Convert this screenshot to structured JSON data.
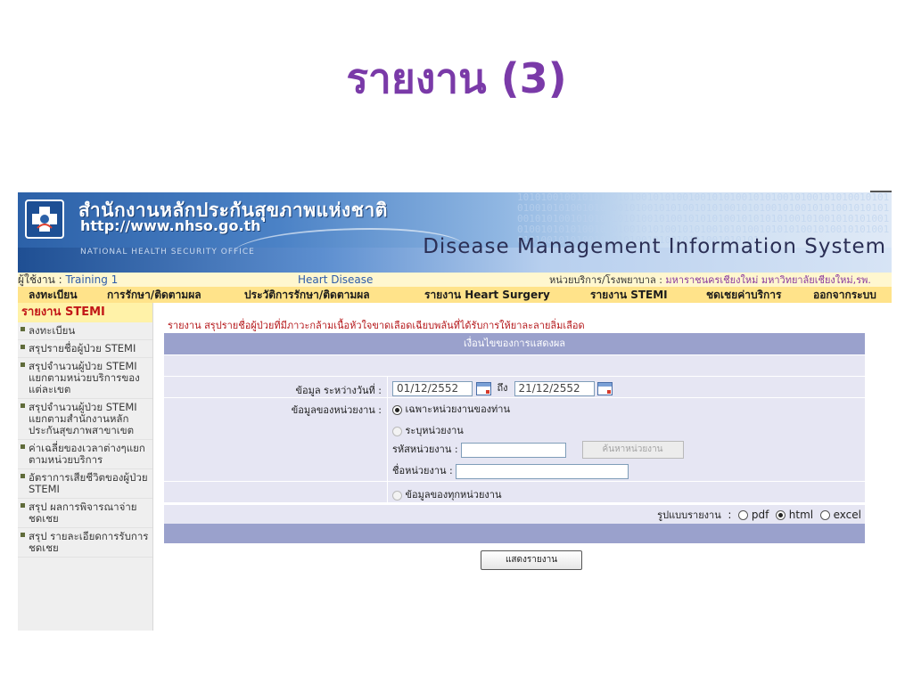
{
  "slide": {
    "title": "รายงาน (3)"
  },
  "banner": {
    "org_name_th": "สำนักงานหลักประกันสุขภาพแห่งชาติ",
    "org_url": "http://www.nhso.go.th",
    "org_name_en": "NATIONAL HEALTH SECURITY OFFICE",
    "system_name": "Disease Management Information System"
  },
  "info_bar": {
    "user_label": "ผู้ใช้งาน : ",
    "user_value": "Training 1",
    "program": "Heart Disease",
    "unit_label": "หน่วยบริการ/โรงพยาบาล : ",
    "unit_value": "มหาราชนครเชียงใหม่ มหาวิทยาลัยเชียงใหม่,รพ."
  },
  "menu": {
    "items": [
      "ลงทะเบียน",
      "การรักษา/ติดตามผล",
      "ประวัติการรักษา/ติดตามผล",
      "รายงาน Heart Surgery",
      "รายงาน STEMI",
      "ชดเชยค่าบริการ",
      "ออกจากระบบ"
    ]
  },
  "sidebar": {
    "header": "รายงาน STEMI",
    "items": [
      "ลงทะเบียน",
      "สรุปรายชื่อผู้ป่วย STEMI",
      "สรุปจำนวนผู้ป่วย STEMI แยกตามหน่วยบริการของแต่ละเขต",
      "สรุปจำนวนผู้ป่วย STEMI แยกตามสำนักงานหลักประกันสุขภาพสาขาเขต",
      "ค่าเฉลี่ยของเวลาต่างๆแยกตามหน่วยบริการ",
      "อัตราการเสียชีวิตของผู้ป่วย STEMI",
      "สรุป ผลการพิจารณาจ่ายชดเชย",
      "สรุป รายละเอียดการรับการชดเชย"
    ]
  },
  "main": {
    "report_title": "รายงาน สรุปรายชื่อผู้ป่วยที่มีภาวะกล้ามเนื้อหัวใจขาดเลือดเฉียบพลันที่ได้รับการให้ยาละลายลิ่มเลือด",
    "conditions_header": "เงื่อนไขของการแสดงผล",
    "date_label": "ข้อมูล ระหว่างวันที่ :",
    "date_from": "01/12/2552",
    "date_to_label": "ถึง",
    "date_to": "21/12/2552",
    "unit_data_label": "ข้อมูลของหน่วยงาน :",
    "opt_own_unit": "เฉพาะหน่วยงานของท่าน",
    "opt_specify_unit": "ระบุหน่วยงาน",
    "unit_code_label": "รหัสหน่วยงาน :",
    "search_unit_button": "ค้นหาหน่วยงาน",
    "unit_name_label": "ชื่อหน่วยงาน :",
    "opt_all_units": "ข้อมูลของทุกหน่วยงาน",
    "format_label": "รูปแบบรายงาน",
    "format_options": [
      "pdf",
      "html",
      "excel"
    ],
    "format_selected": "html",
    "show_report_button": "แสดงรายงาน"
  }
}
